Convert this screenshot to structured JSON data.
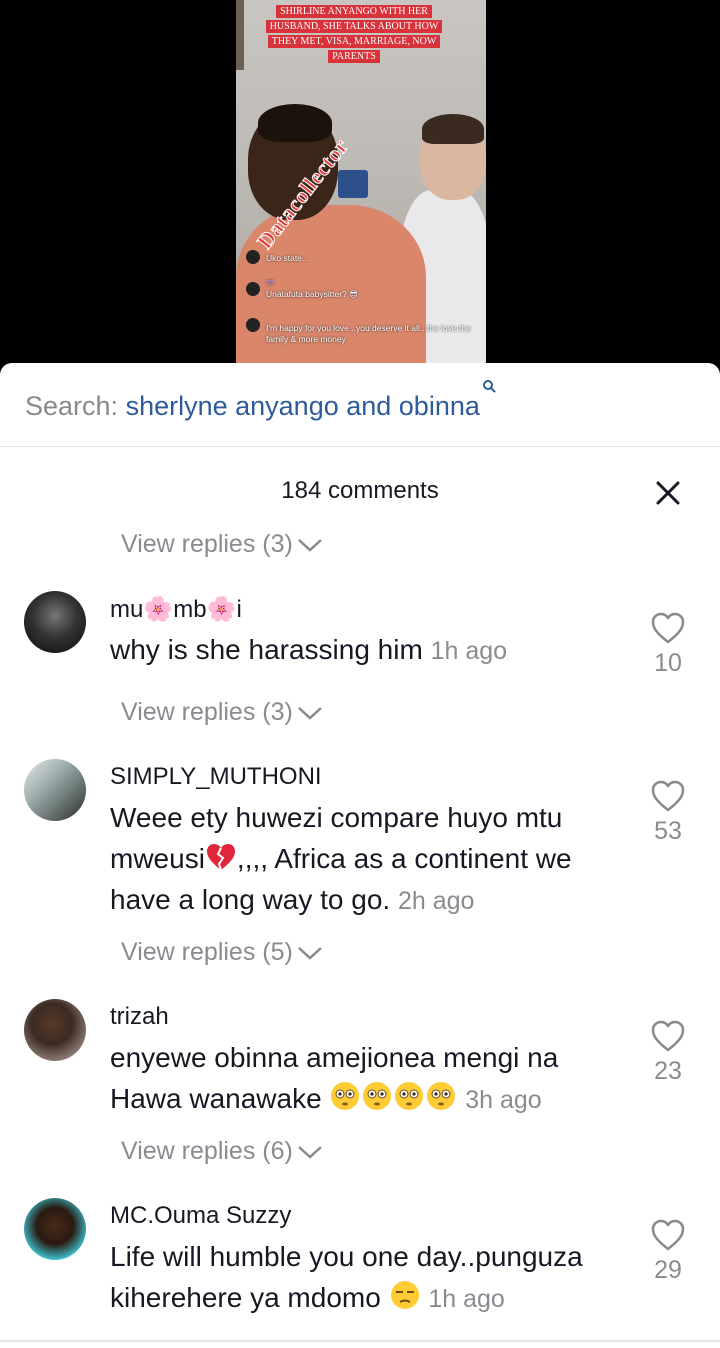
{
  "video": {
    "caption": "SHIRLINE ANYANGO WITH HER HUSBAND, SHE TALKS ABOUT HOW THEY MET, VISA, MARRIAGE, NOW PARENTS",
    "watermark": "Datacollector",
    "live_comments": [
      {
        "text": "Uko state..."
      },
      {
        "text": "Unatafuta babysitter? 😎",
        "badge": "25"
      },
      {
        "text": "I'm happy for you love...you deserve it all...the love.the family & more money"
      }
    ]
  },
  "search": {
    "label": "Search:",
    "query": "sherlyne anyango and obinna"
  },
  "header": {
    "count_label": "184 comments"
  },
  "replies_top": "View replies (3)",
  "comments": [
    {
      "username": "mu🌸mb🌸i",
      "text": "why is she harassing him",
      "time": "1h ago",
      "likes": "10",
      "replies": "View replies (3)"
    },
    {
      "username": "SIMPLY_MUTHONI",
      "text_a": "Weee ety huwezi compare huyo mtu mweusi",
      "text_b": ",,,, Africa as a continent we have a long way to go.",
      "time": "2h ago",
      "likes": "53",
      "replies": "View replies (5)"
    },
    {
      "username": "trizah",
      "text": "enyewe obinna amejionea mengi na Hawa wanawake",
      "time": "3h ago",
      "likes": "23",
      "replies": "View replies (6)"
    },
    {
      "username": "MC.Ouma Suzzy",
      "text": "Life will humble you one day..punguza kiherehere ya mdomo",
      "time": "1h ago",
      "likes": "29"
    }
  ],
  "colors": {
    "query_blue": "#2e5b9b",
    "muted_gray": "#8a8b91",
    "text_dark": "#161823",
    "caption_red": "#d8323a"
  },
  "icons": [
    "search-icon",
    "close-icon",
    "chevron-down-icon",
    "heart-outline-icon",
    "broken-heart-emoji",
    "flushed-face-emoji"
  ]
}
